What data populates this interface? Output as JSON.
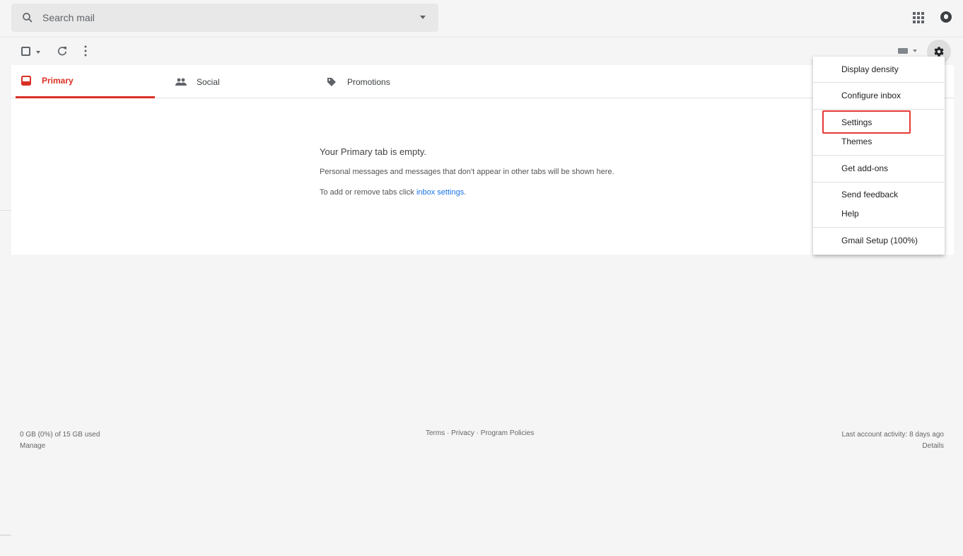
{
  "search": {
    "placeholder": "Search mail"
  },
  "header": {
    "apps_icon": "apps-grid-icon",
    "account_icon": "account-icon"
  },
  "toolbar": {
    "select_icon": "checkbox-icon",
    "refresh_icon": "refresh-icon",
    "more_icon": "more-vert-icon",
    "keyboard_icon": "keyboard-icon",
    "settings_icon": "gear-icon"
  },
  "tabs": [
    {
      "label": "Primary",
      "icon": "inbox-icon",
      "active": true
    },
    {
      "label": "Social",
      "icon": "people-icon",
      "active": false
    },
    {
      "label": "Promotions",
      "icon": "tag-icon",
      "active": false
    }
  ],
  "empty": {
    "title": "Your Primary tab is empty.",
    "message": "Personal messages and messages that don't appear in other tabs will be shown here.",
    "hint_prefix": "To add or remove tabs click ",
    "hint_link": "inbox settings",
    "hint_suffix": "."
  },
  "footer": {
    "storage": "0 GB (0%) of 15 GB used",
    "manage": "Manage",
    "links": "Terms · Privacy · Program Policies",
    "activity": "Last account activity: 8 days ago",
    "details": "Details"
  },
  "settings_menu": {
    "items": [
      "Display density",
      "Configure inbox",
      "Settings",
      "Themes",
      "Get add-ons",
      "Send feedback",
      "Help",
      "Gmail Setup (100%)"
    ]
  },
  "colors": {
    "accent": "#d93025",
    "link": "#1a73e8",
    "highlight": "#e53935"
  }
}
